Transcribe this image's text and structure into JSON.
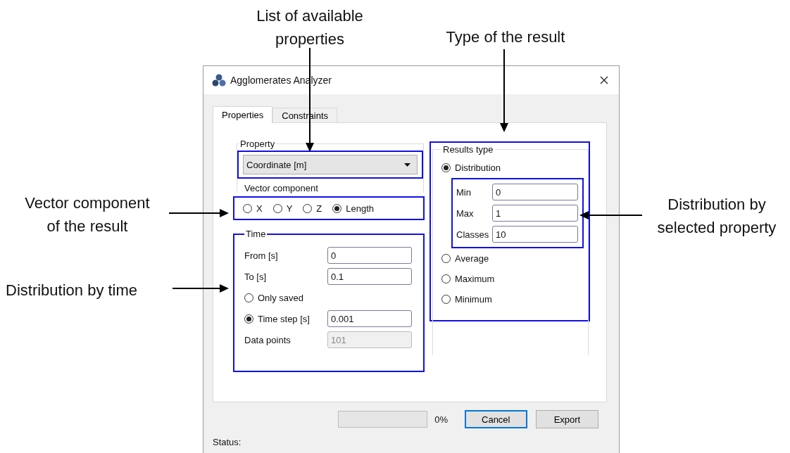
{
  "callouts": [
    {
      "lines": [
        "List of available",
        "properties"
      ]
    },
    {
      "lines": [
        "Type of the result"
      ]
    },
    {
      "lines": [
        "Vector component",
        "of the result"
      ]
    },
    {
      "lines": [
        "Distribution by time"
      ]
    },
    {
      "lines": [
        "Distribution by",
        "selected property"
      ]
    }
  ],
  "window": {
    "title": "Agglomerates Analyzer"
  },
  "tabs": [
    {
      "label": "Properties",
      "selected": true
    },
    {
      "label": "Constraints",
      "selected": false
    }
  ],
  "property": {
    "group_label": "Property",
    "value": "Coordinate [m]"
  },
  "vector_component": {
    "label": "Vector component",
    "options": [
      {
        "label": "X",
        "selected": false
      },
      {
        "label": "Y",
        "selected": false
      },
      {
        "label": "Z",
        "selected": false
      },
      {
        "label": "Length",
        "selected": true
      }
    ]
  },
  "time": {
    "title": "Time",
    "fields": [
      {
        "label": "From [s]",
        "value": "0"
      },
      {
        "label": "To [s]",
        "value": "0.1"
      }
    ],
    "only_saved": {
      "label": "Only saved",
      "selected": false
    },
    "time_step": {
      "label": "Time step [s]",
      "selected": true,
      "value": "0.001"
    },
    "data_points": {
      "label": "Data points",
      "value": "101",
      "disabled": true
    }
  },
  "results_type": {
    "title": "Results type",
    "distribution": {
      "label": "Distribution",
      "selected": true,
      "fields": [
        {
          "label": "Min",
          "value": "0"
        },
        {
          "label": "Max",
          "value": "1"
        },
        {
          "label": "Classes",
          "value": "10"
        }
      ]
    },
    "others": [
      {
        "label": "Average",
        "selected": false
      },
      {
        "label": "Maximum",
        "selected": false
      },
      {
        "label": "Minimum",
        "selected": false
      }
    ]
  },
  "progress": {
    "level": 0,
    "reading": "0%"
  },
  "buttons": [
    {
      "label": "Cancel",
      "focused": true
    },
    {
      "label": "Export",
      "focused": false
    }
  ],
  "status": "Status:"
}
